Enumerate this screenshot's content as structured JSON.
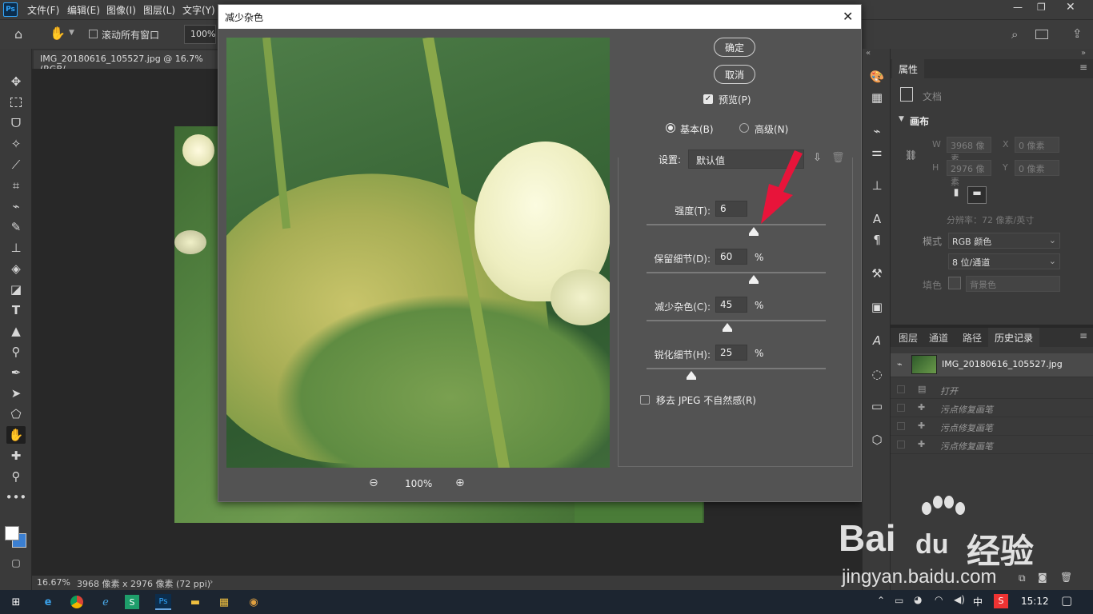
{
  "menubar": {
    "ps_logo": "Ps",
    "items": [
      "文件(F)",
      "编辑(E)",
      "图像(I)",
      "图层(L)",
      "文字(Y)"
    ]
  },
  "options": {
    "scroll_all_label": "滚动所有窗口",
    "zoom_value": "100%"
  },
  "document": {
    "tab_title": "IMG_20180616_105527.jpg @ 16.7%(RGB/"
  },
  "status": {
    "zoom": "16.67%",
    "info": "3968 像素 x 2976 像素 (72 ppi)"
  },
  "dialog": {
    "title": "减少杂色",
    "ok_label": "确定",
    "cancel_label": "取消",
    "preview_label": "预览(P)",
    "preview_checked": true,
    "mode_basic": "基本(B)",
    "mode_advanced": "高级(N)",
    "mode_selected": "basic",
    "settings_label": "设置:",
    "settings_value": "默认值",
    "sliders": [
      {
        "label": "强度(T):",
        "value": "6",
        "unit": "",
        "fraction": 0.6
      },
      {
        "label": "保留细节(D):",
        "value": "60",
        "unit": "%",
        "fraction": 0.6
      },
      {
        "label": "减少杂色(C):",
        "value": "45",
        "unit": "%",
        "fraction": 0.45
      },
      {
        "label": "锐化细节(H):",
        "value": "25",
        "unit": "%",
        "fraction": 0.25
      }
    ],
    "jpeg_label": "移去 JPEG 不自然感(R)",
    "jpeg_checked": false,
    "preview_zoom": "100%",
    "accent_arrow_color": "#e8143a"
  },
  "properties": {
    "tab": "属性",
    "doc_label": "文档",
    "section": "画布",
    "w_label": "W",
    "w_value": "3968 像素",
    "x_label": "X",
    "x_value": "0 像素",
    "h_label": "H",
    "h_value": "2976 像素",
    "y_label": "Y",
    "y_value": "0 像素",
    "resolution": "分辨率：72 像素/英寸",
    "mode_label": "模式",
    "mode_value": "RGB 颜色",
    "depth_value": "8 位/通道",
    "fill_label": "填色",
    "fill_value": "背景色"
  },
  "history": {
    "tabs": [
      "图层",
      "通道",
      "路径",
      "历史记录"
    ],
    "active_tab": "历史记录",
    "snapshot": "IMG_20180616_105527.jpg",
    "states": [
      "打开",
      "污点修复画笔",
      "污点修复画笔",
      "污点修复画笔"
    ]
  },
  "watermark": {
    "brand": "Bai",
    "brand2": "du",
    "cn": "经验",
    "url": "jingyan.baidu.com"
  },
  "taskbar": {
    "ime": "中",
    "time": "15:12"
  }
}
